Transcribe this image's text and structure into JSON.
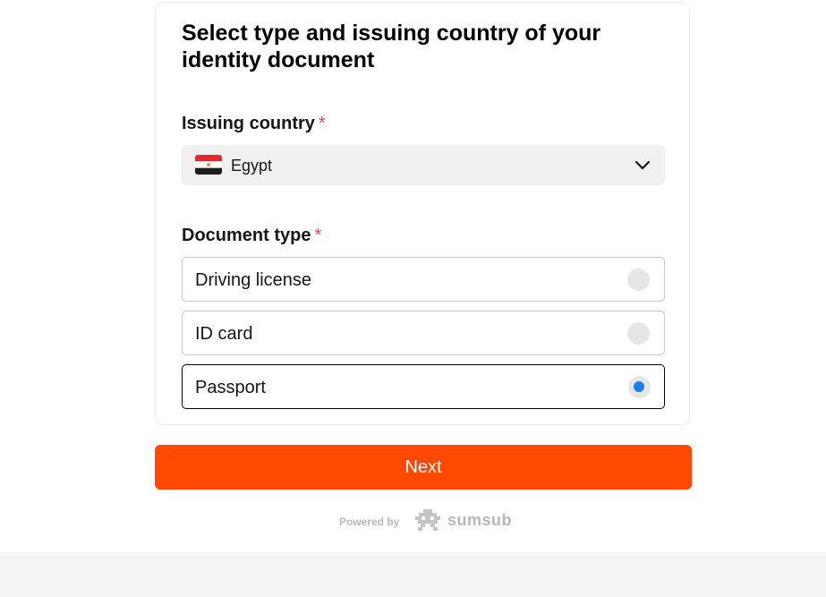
{
  "colors": {
    "accent": "#ff4800",
    "required": "#e5484d",
    "radio_selected": "#1a7fe6",
    "select_bg": "#eff0f0"
  },
  "form": {
    "title": "Select type and issuing country of your identity document",
    "country_label": "Issuing country",
    "required_mark": "*",
    "country": {
      "flag_icon": "egypt-flag-icon",
      "value": "Egypt"
    },
    "doc_type_label": "Document type",
    "document_types": [
      {
        "label": "Driving license",
        "selected": false
      },
      {
        "label": "ID card",
        "selected": false
      },
      {
        "label": "Passport",
        "selected": true
      }
    ]
  },
  "actions": {
    "next_label": "Next"
  },
  "branding": {
    "powered_by": "Powered by",
    "brand": "sumsub",
    "logo_icon": "sumsub-logo-icon"
  }
}
